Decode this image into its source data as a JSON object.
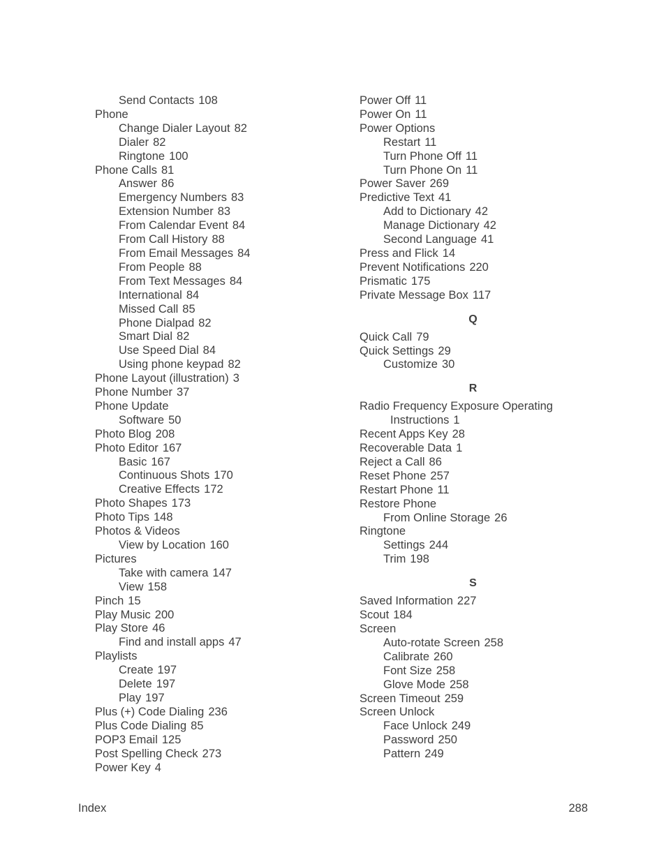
{
  "left_column": [
    {
      "term": "Send Contacts",
      "page": "108",
      "level": 2
    },
    {
      "term": "Phone",
      "page": "",
      "level": 1
    },
    {
      "term": "Change Dialer Layout",
      "page": "82",
      "level": 2
    },
    {
      "term": "Dialer",
      "page": "82",
      "level": 2
    },
    {
      "term": "Ringtone",
      "page": "100",
      "level": 2
    },
    {
      "term": "Phone Calls",
      "page": "81",
      "level": 1
    },
    {
      "term": "Answer",
      "page": "86",
      "level": 2
    },
    {
      "term": "Emergency Numbers",
      "page": "83",
      "level": 2
    },
    {
      "term": "Extension Number",
      "page": "83",
      "level": 2
    },
    {
      "term": "From Calendar Event",
      "page": "84",
      "level": 2
    },
    {
      "term": "From Call History",
      "page": "88",
      "level": 2
    },
    {
      "term": "From Email Messages",
      "page": "84",
      "level": 2
    },
    {
      "term": "From People",
      "page": "88",
      "level": 2
    },
    {
      "term": "From Text Messages",
      "page": "84",
      "level": 2
    },
    {
      "term": "International",
      "page": "84",
      "level": 2
    },
    {
      "term": "Missed Call",
      "page": "85",
      "level": 2
    },
    {
      "term": "Phone Dialpad",
      "page": "82",
      "level": 2
    },
    {
      "term": "Smart Dial",
      "page": "82",
      "level": 2
    },
    {
      "term": "Use Speed Dial",
      "page": "84",
      "level": 2
    },
    {
      "term": "Using phone keypad",
      "page": "82",
      "level": 2
    },
    {
      "term": "Phone Layout (illustration)",
      "page": "3",
      "level": 1
    },
    {
      "term": "Phone Number",
      "page": "37",
      "level": 1
    },
    {
      "term": "Phone Update",
      "page": "",
      "level": 1
    },
    {
      "term": "Software",
      "page": "50",
      "level": 2
    },
    {
      "term": "Photo Blog",
      "page": "208",
      "level": 1
    },
    {
      "term": "Photo Editor",
      "page": "167",
      "level": 1
    },
    {
      "term": "Basic",
      "page": "167",
      "level": 2
    },
    {
      "term": "Continuous Shots",
      "page": "170",
      "level": 2
    },
    {
      "term": "Creative Effects",
      "page": "172",
      "level": 2
    },
    {
      "term": "Photo Shapes",
      "page": "173",
      "level": 1
    },
    {
      "term": "Photo Tips",
      "page": "148",
      "level": 1
    },
    {
      "term": "Photos & Videos",
      "page": "",
      "level": 1
    },
    {
      "term": "View by Location",
      "page": "160",
      "level": 2
    },
    {
      "term": "Pictures",
      "page": "",
      "level": 1
    },
    {
      "term": "Take with camera",
      "page": "147",
      "level": 2
    },
    {
      "term": "View",
      "page": "158",
      "level": 2
    },
    {
      "term": "Pinch",
      "page": "15",
      "level": 1
    },
    {
      "term": "Play Music",
      "page": "200",
      "level": 1
    },
    {
      "term": "Play Store",
      "page": "46",
      "level": 1
    },
    {
      "term": "Find and install apps",
      "page": "47",
      "level": 2
    },
    {
      "term": "Playlists",
      "page": "",
      "level": 1
    },
    {
      "term": "Create",
      "page": "197",
      "level": 2
    },
    {
      "term": "Delete",
      "page": "197",
      "level": 2
    },
    {
      "term": "Play",
      "page": "197",
      "level": 2
    },
    {
      "term": "Plus (+) Code Dialing",
      "page": "236",
      "level": 1
    },
    {
      "term": "Plus Code Dialing",
      "page": "85",
      "level": 1
    },
    {
      "term": "POP3 Email",
      "page": "125",
      "level": 1
    },
    {
      "term": "Post Spelling Check",
      "page": "273",
      "level": 1
    },
    {
      "term": "Power Key",
      "page": "4",
      "level": 1
    }
  ],
  "right_column": [
    {
      "term": "Power Off",
      "page": "11",
      "level": 1
    },
    {
      "term": "Power On",
      "page": "11",
      "level": 1
    },
    {
      "term": "Power Options",
      "page": "",
      "level": 1
    },
    {
      "term": "Restart",
      "page": "11",
      "level": 2
    },
    {
      "term": "Turn Phone Off",
      "page": "11",
      "level": 2
    },
    {
      "term": "Turn Phone On",
      "page": "11",
      "level": 2
    },
    {
      "term": "Power Saver",
      "page": "269",
      "level": 1
    },
    {
      "term": "Predictive Text",
      "page": "41",
      "level": 1
    },
    {
      "term": "Add to Dictionary",
      "page": "42",
      "level": 2
    },
    {
      "term": "Manage Dictionary",
      "page": "42",
      "level": 2
    },
    {
      "term": "Second Language",
      "page": "41",
      "level": 2
    },
    {
      "term": "Press and Flick",
      "page": "14",
      "level": 1
    },
    {
      "term": "Prevent Notifications",
      "page": "220",
      "level": 1
    },
    {
      "term": "Prismatic",
      "page": "175",
      "level": 1
    },
    {
      "term": "Private Message Box",
      "page": "117",
      "level": 1
    },
    {
      "letter": "Q"
    },
    {
      "term": "Quick Call",
      "page": "79",
      "level": 1
    },
    {
      "term": "Quick Settings",
      "page": "29",
      "level": 1
    },
    {
      "term": "Customize",
      "page": "30",
      "level": 2
    },
    {
      "letter": "R"
    },
    {
      "term": "Radio Frequency Exposure Operating",
      "continuation": "Instructions",
      "page": "1",
      "level": 1
    },
    {
      "term": "Recent Apps Key",
      "page": "28",
      "level": 1
    },
    {
      "term": "Recoverable Data",
      "page": "1",
      "level": 1
    },
    {
      "term": "Reject a Call",
      "page": "86",
      "level": 1
    },
    {
      "term": "Reset Phone",
      "page": "257",
      "level": 1
    },
    {
      "term": "Restart Phone",
      "page": "11",
      "level": 1
    },
    {
      "term": "Restore Phone",
      "page": "",
      "level": 1
    },
    {
      "term": "From Online Storage",
      "page": "26",
      "level": 2
    },
    {
      "term": "Ringtone",
      "page": "",
      "level": 1
    },
    {
      "term": "Settings",
      "page": "244",
      "level": 2
    },
    {
      "term": "Trim",
      "page": "198",
      "level": 2
    },
    {
      "letter": "S"
    },
    {
      "term": "Saved Information",
      "page": "227",
      "level": 1
    },
    {
      "term": "Scout",
      "page": "184",
      "level": 1
    },
    {
      "term": "Screen",
      "page": "",
      "level": 1
    },
    {
      "term": "Auto-rotate Screen",
      "page": "258",
      "level": 2
    },
    {
      "term": "Calibrate",
      "page": "260",
      "level": 2
    },
    {
      "term": "Font Size",
      "page": "258",
      "level": 2
    },
    {
      "term": "Glove Mode",
      "page": "258",
      "level": 2
    },
    {
      "term": "Screen Timeout",
      "page": "259",
      "level": 1
    },
    {
      "term": "Screen Unlock",
      "page": "",
      "level": 1
    },
    {
      "term": "Face Unlock",
      "page": "249",
      "level": 2
    },
    {
      "term": "Password",
      "page": "250",
      "level": 2
    },
    {
      "term": "Pattern",
      "page": "249",
      "level": 2
    }
  ],
  "footer": {
    "section": "Index",
    "page_number": "288"
  }
}
